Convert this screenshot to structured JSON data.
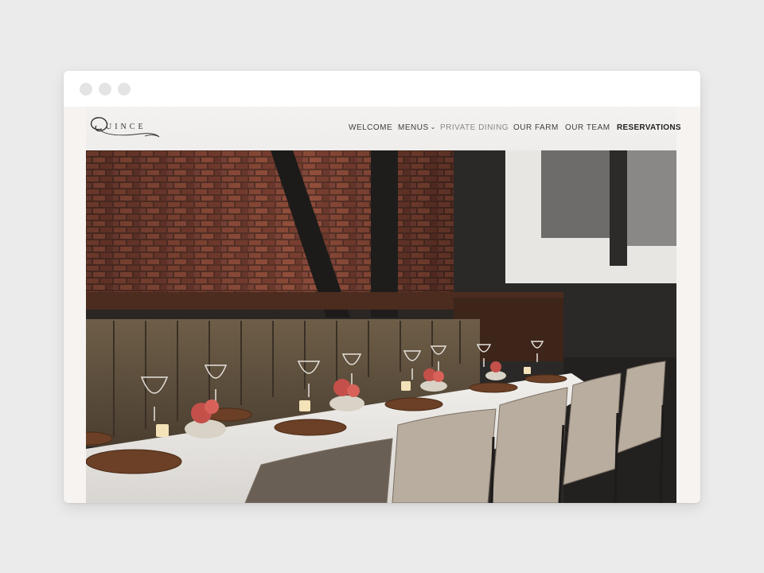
{
  "browser": {
    "dots": [
      "close",
      "minimize",
      "maximize"
    ]
  },
  "site": {
    "logo_text": "UINCE",
    "nav": [
      {
        "label": "WELCOME"
      },
      {
        "label": "MENUS",
        "has_dropdown": true
      },
      {
        "label": "PRIVATE DINING",
        "active": true
      },
      {
        "label": "OUR FARM"
      },
      {
        "label": "OUR TEAM"
      },
      {
        "label": "RESERVATIONS"
      }
    ]
  },
  "hero": {
    "image_alt": "Private dining room with brick wall, banquette and long set table"
  },
  "colors": {
    "page_bg": "#ebebeb",
    "site_bg": "#f6f3f1",
    "nav_text": "#3e3e3e",
    "nav_active": "#8a8684"
  }
}
